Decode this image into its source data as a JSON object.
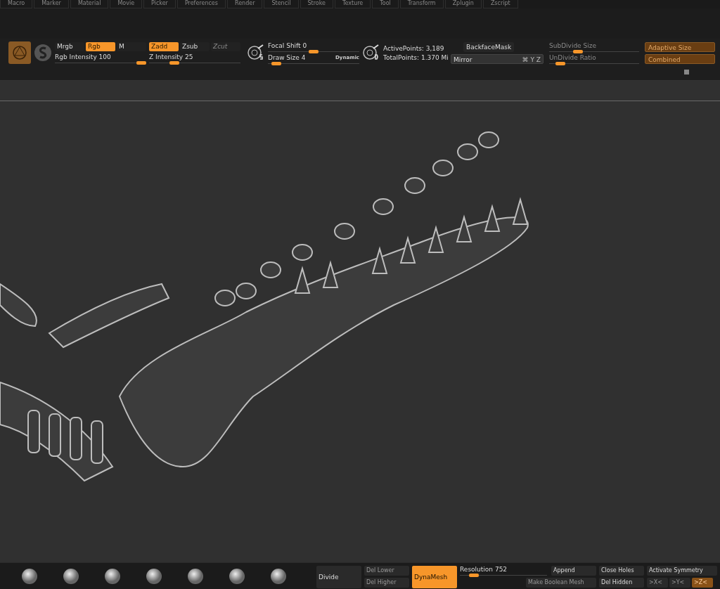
{
  "menu": [
    "Macro",
    "Marker",
    "Material",
    "Movie",
    "Picker",
    "Preferences",
    "Render",
    "Stencil",
    "Stroke",
    "Texture",
    "Tool",
    "Transform",
    "Zplugin",
    "Zscript"
  ],
  "color_modes": [
    {
      "label": "Mrgb",
      "selected": false
    },
    {
      "label": "Rgb",
      "selected": true
    },
    {
      "label": "M",
      "selected": false
    }
  ],
  "z_modes": [
    {
      "label": "Zadd",
      "selected": true,
      "disabled": false
    },
    {
      "label": "Zsub",
      "selected": false,
      "disabled": false
    },
    {
      "label": "Zcut",
      "selected": false,
      "disabled": true
    }
  ],
  "rgb_intensity": {
    "label": "Rgb Intensity",
    "value": "100",
    "level": 1
  },
  "z_intensity": {
    "label": "Z Intensity",
    "value": "25",
    "level": 0.25
  },
  "focal_shift": {
    "label": "Focal Shift",
    "value": "0",
    "level": 0.5
  },
  "draw_size": {
    "label": "Draw Size",
    "value": "4",
    "level": 0.04,
    "badge": "Dynamic"
  },
  "points": {
    "active": "ActivePoints: 3,189",
    "total": "TotalPoints: 1.370 Mi"
  },
  "backface_mask": "BackfaceMask",
  "mirror": {
    "label": "Mirror",
    "axes": "⌘ Y Z"
  },
  "subdivide": [
    {
      "label": "SubDivide Size",
      "level": 0.3
    },
    {
      "label": "UnDivide Ratio",
      "level": 0.08
    }
  ],
  "subdivide_buttons": [
    "Adaptive Size",
    "Combined"
  ],
  "geometry": {
    "divide": "Divide",
    "del_lower": "Del Lower",
    "del_higher": "Del Higher",
    "dynamesh": "DynaMesh",
    "resolution": {
      "label": "Resolution",
      "value": "752",
      "level": 0.12
    },
    "append": "Append",
    "close_holes": "Close Holes",
    "make_boolean": "Make Boolean Mesh",
    "del_hidden": "Del Hidden",
    "activate_symmetry": "Activate Symmetry",
    "symmetry": [
      {
        "label": ">X<",
        "selected": false
      },
      {
        "label": ">Y<",
        "selected": false
      },
      {
        "label": ">Z<",
        "selected": true
      }
    ]
  }
}
